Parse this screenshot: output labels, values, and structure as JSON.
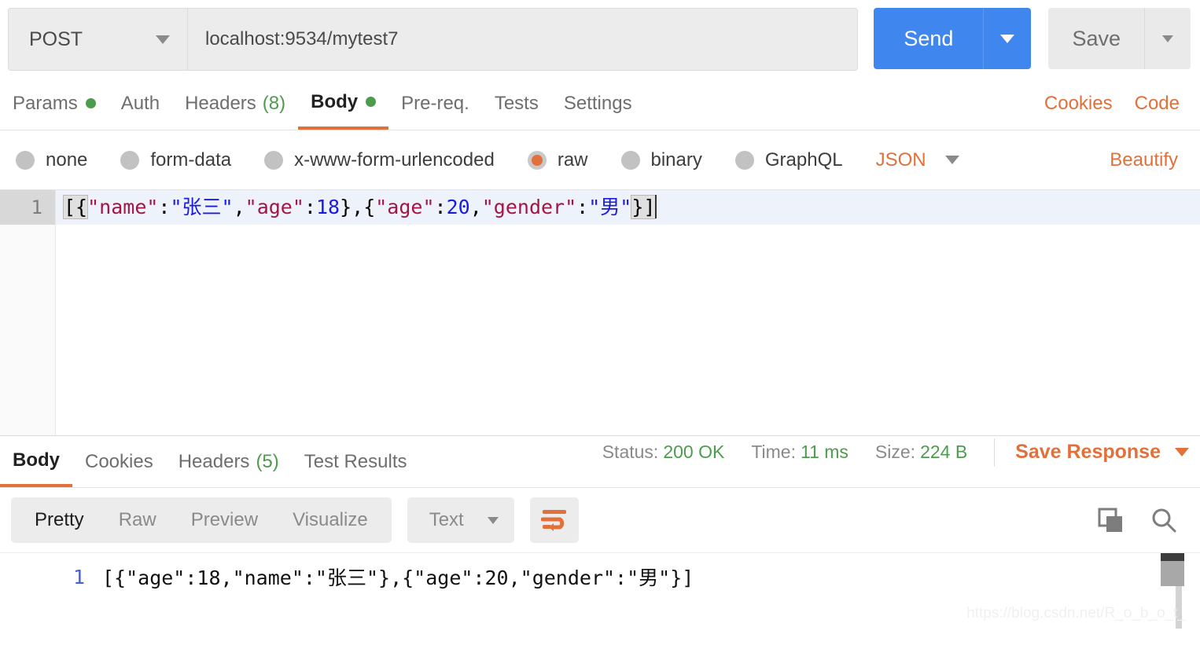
{
  "request": {
    "method": "POST",
    "url": "localhost:9534/mytest7",
    "send_label": "Send",
    "save_label": "Save",
    "tabs": [
      {
        "label": "Params",
        "dot": true,
        "count": null,
        "active": false
      },
      {
        "label": "Auth",
        "dot": false,
        "count": null,
        "active": false
      },
      {
        "label": "Headers",
        "dot": false,
        "count": "(8)",
        "active": false
      },
      {
        "label": "Body",
        "dot": true,
        "count": null,
        "active": true
      },
      {
        "label": "Pre-req.",
        "dot": false,
        "count": null,
        "active": false
      },
      {
        "label": "Tests",
        "dot": false,
        "count": null,
        "active": false
      },
      {
        "label": "Settings",
        "dot": false,
        "count": null,
        "active": false
      }
    ],
    "tab_links": [
      {
        "label": "Cookies"
      },
      {
        "label": "Code"
      }
    ],
    "body_types": [
      {
        "label": "none",
        "checked": false
      },
      {
        "label": "form-data",
        "checked": false
      },
      {
        "label": "x-www-form-urlencoded",
        "checked": false
      },
      {
        "label": "raw",
        "checked": true
      },
      {
        "label": "binary",
        "checked": false
      },
      {
        "label": "GraphQL",
        "checked": false
      }
    ],
    "format": "JSON",
    "beautify_label": "Beautify",
    "editor": {
      "line_number": "1",
      "raw_text": "[{\"name\":\"张三\",\"age\":18},{\"age\":20,\"gender\":\"男\"}]",
      "tokens": [
        {
          "text": "[{",
          "type": "punc"
        },
        {
          "text": "\"name\"",
          "type": "key"
        },
        {
          "text": ":",
          "type": "punc"
        },
        {
          "text": "\"张三\"",
          "type": "string"
        },
        {
          "text": ",",
          "type": "punc"
        },
        {
          "text": "\"age\"",
          "type": "key"
        },
        {
          "text": ":",
          "type": "punc"
        },
        {
          "text": "18",
          "type": "num"
        },
        {
          "text": "},{",
          "type": "punc"
        },
        {
          "text": "\"age\"",
          "type": "key"
        },
        {
          "text": ":",
          "type": "punc"
        },
        {
          "text": "20",
          "type": "num"
        },
        {
          "text": ",",
          "type": "punc"
        },
        {
          "text": "\"gender\"",
          "type": "key"
        },
        {
          "text": ":",
          "type": "punc"
        },
        {
          "text": "\"男\"",
          "type": "string"
        },
        {
          "text": "}]",
          "type": "punc"
        }
      ]
    }
  },
  "response": {
    "tabs": [
      {
        "label": "Body",
        "count": null,
        "active": true
      },
      {
        "label": "Cookies",
        "count": null,
        "active": false
      },
      {
        "label": "Headers",
        "count": "(5)",
        "active": false
      },
      {
        "label": "Test Results",
        "count": null,
        "active": false
      }
    ],
    "meta": {
      "status_label": "Status:",
      "status_value": "200 OK",
      "time_label": "Time:",
      "time_value": "11 ms",
      "size_label": "Size:",
      "size_value": "224 B"
    },
    "save_response_label": "Save Response",
    "view_modes": [
      {
        "label": "Pretty",
        "active": true
      },
      {
        "label": "Raw",
        "active": false
      },
      {
        "label": "Preview",
        "active": false
      },
      {
        "label": "Visualize",
        "active": false
      }
    ],
    "content_type": "Text",
    "body": {
      "line_number": "1",
      "text": "[{\"age\":18,\"name\":\"张三\"},{\"age\":20,\"gender\":\"男\"}]"
    }
  },
  "watermark": "https://blog.csdn.net/R_o_b_o_t_",
  "colors": {
    "accent_orange": "#e2703a",
    "send_blue": "#3f86ef",
    "status_green": "#4d9c4d",
    "json_key": "#a31545",
    "json_string": "#1a1ae0"
  }
}
